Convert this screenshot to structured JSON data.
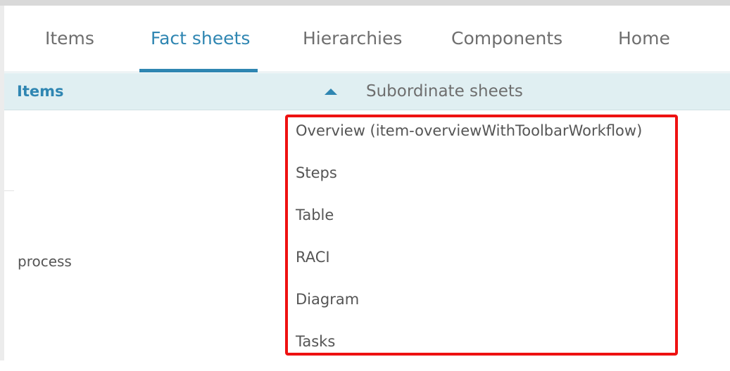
{
  "tabs": [
    {
      "label": "Items",
      "active": false
    },
    {
      "label": "Fact sheets",
      "active": true
    },
    {
      "label": "Hierarchies",
      "active": false
    },
    {
      "label": "Components",
      "active": false
    },
    {
      "label": "Home",
      "active": false
    }
  ],
  "table_header": {
    "items_label": "Items",
    "sort_direction": "ascending",
    "subordinate_label": "Subordinate sheets"
  },
  "row": {
    "item": "process",
    "sheets": [
      "Overview (item-overviewWithToolbarWorkflow)",
      "Steps",
      "Table",
      "RACI",
      "Diagram",
      "Tasks"
    ]
  },
  "colors": {
    "accent": "#2f86b2",
    "header_bg": "#e0eff2",
    "highlight": "#ee1111",
    "text": "#555555"
  }
}
